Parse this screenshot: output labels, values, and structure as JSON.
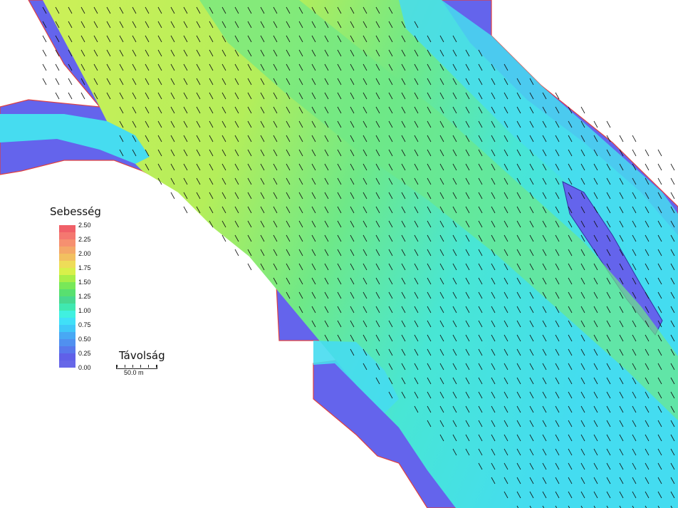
{
  "legend": {
    "title": "Sebesség",
    "ticks": [
      "2.50",
      "2.25",
      "2.00",
      "1.75",
      "1.50",
      "1.25",
      "1.00",
      "0.75",
      "0.50",
      "0.25",
      "0.00"
    ],
    "colors": [
      "#f06068",
      "#f47870",
      "#f69070",
      "#f4a868",
      "#f2c060",
      "#eedc58",
      "#d8f04a",
      "#a8ee48",
      "#78e858",
      "#58e070",
      "#48d890",
      "#40e8b0",
      "#40f0e0",
      "#40e0f8",
      "#40c8f8",
      "#48a8f4",
      "#5090f0",
      "#5878ec",
      "#6060e8",
      "#6868e8"
    ]
  },
  "scale": {
    "title": "Távolság",
    "label": "50.0 m"
  },
  "colors": {
    "dry": "#6464ec",
    "shallow": "#46dcf0",
    "mid": "#5ce89c",
    "fast": "#b8f058",
    "bank": "#e04040"
  }
}
